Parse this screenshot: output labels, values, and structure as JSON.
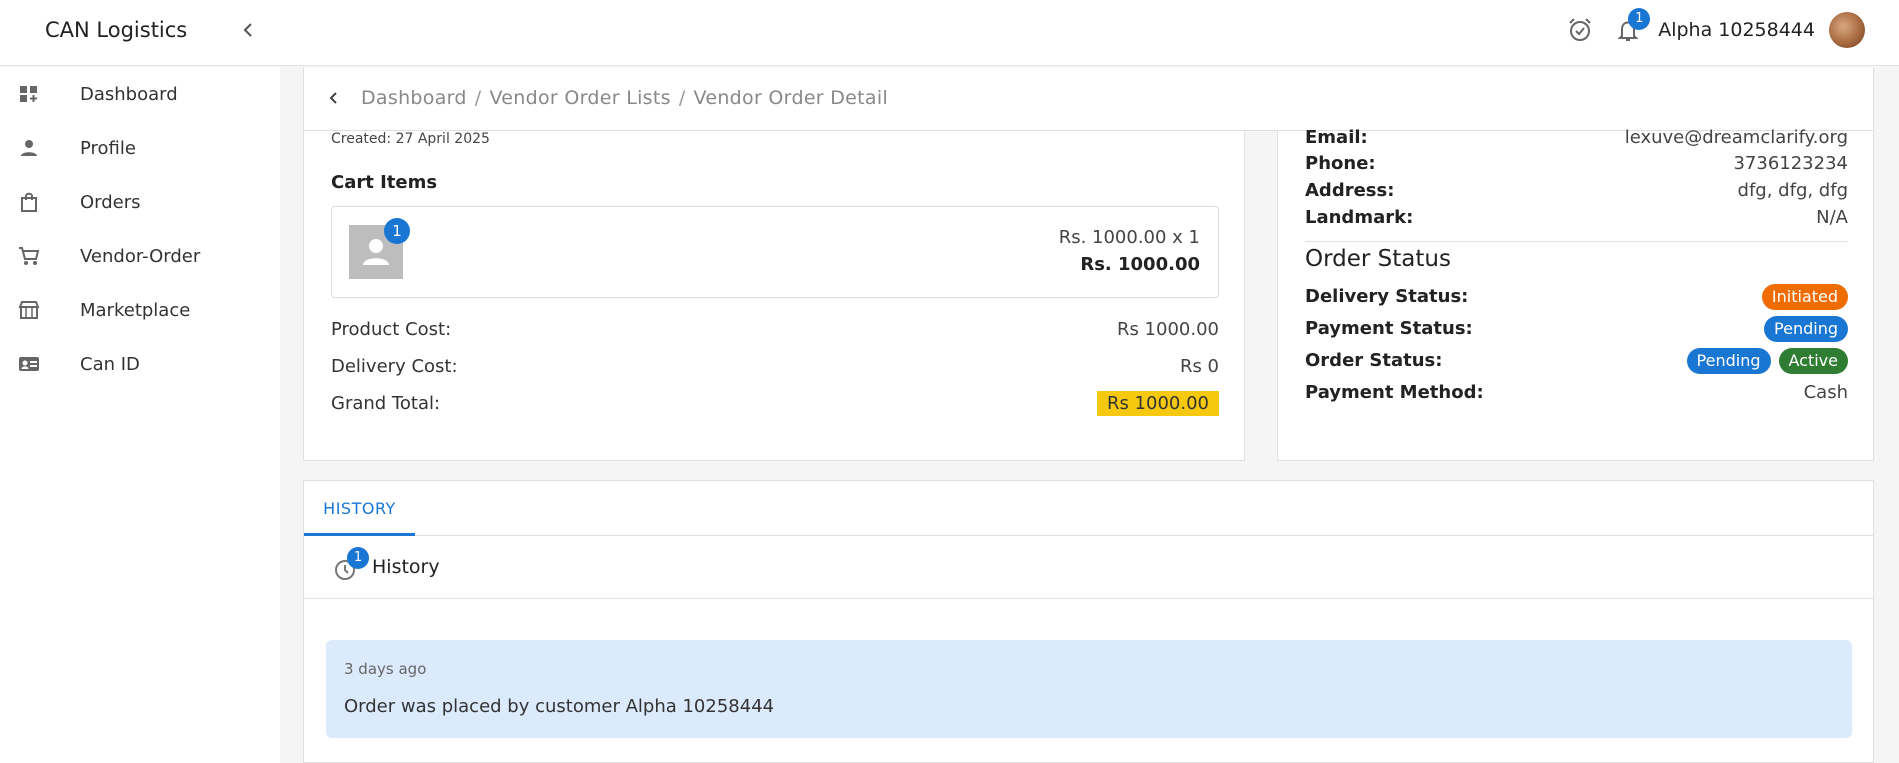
{
  "header": {
    "brand": "CAN Logistics",
    "notification_count": "1",
    "username": "Alpha 10258444"
  },
  "sidebar": {
    "items": [
      {
        "label": "Dashboard",
        "icon": "dashboard-icon"
      },
      {
        "label": "Profile",
        "icon": "person-icon"
      },
      {
        "label": "Orders",
        "icon": "shopping-bag-icon"
      },
      {
        "label": "Vendor-Order",
        "icon": "cart-icon"
      },
      {
        "label": "Marketplace",
        "icon": "store-icon"
      },
      {
        "label": "Can ID",
        "icon": "id-card-icon"
      }
    ]
  },
  "breadcrumb": {
    "items": [
      "Dashboard",
      "Vendor Order Lists",
      "Vendor Order Detail"
    ],
    "separator": "/"
  },
  "order": {
    "created": "Created: 27 April 2025",
    "cart_title": "Cart Items",
    "item": {
      "badge": "1",
      "price_line": "Rs. 1000.00 x 1",
      "total_line": "Rs. 1000.00"
    },
    "costs": {
      "product_label": "Product Cost:",
      "product_value": "Rs 1000.00",
      "delivery_label": "Delivery Cost:",
      "delivery_value": "Rs 0",
      "grand_label": "Grand Total:",
      "grand_value": "Rs 1000.00"
    }
  },
  "customer": {
    "email_label": "Email:",
    "email": "lexuve@dreamclarify.org",
    "phone_label": "Phone:",
    "phone": "3736123234",
    "address_label": "Address:",
    "address": "dfg, dfg, dfg",
    "landmark_label": "Landmark:",
    "landmark": "N/A"
  },
  "order_status": {
    "title": "Order Status",
    "delivery_label": "Delivery Status:",
    "delivery_value": "Initiated",
    "payment_label": "Payment Status:",
    "payment_value": "Pending",
    "order_label": "Order Status:",
    "order_value_1": "Pending",
    "order_value_2": "Active",
    "method_label": "Payment Method:",
    "method_value": "Cash"
  },
  "history": {
    "tab": "HISTORY",
    "title": "History",
    "badge": "1",
    "entries": [
      {
        "time": "3 days ago",
        "text": "Order was placed by customer Alpha 10258444"
      }
    ]
  },
  "colors": {
    "accent": "#1976d2",
    "initiated": "#ef6c00",
    "active": "#2e7d32",
    "grand_total_highlight": "#f6c90e",
    "history_entry_bg": "#dbeafd"
  }
}
